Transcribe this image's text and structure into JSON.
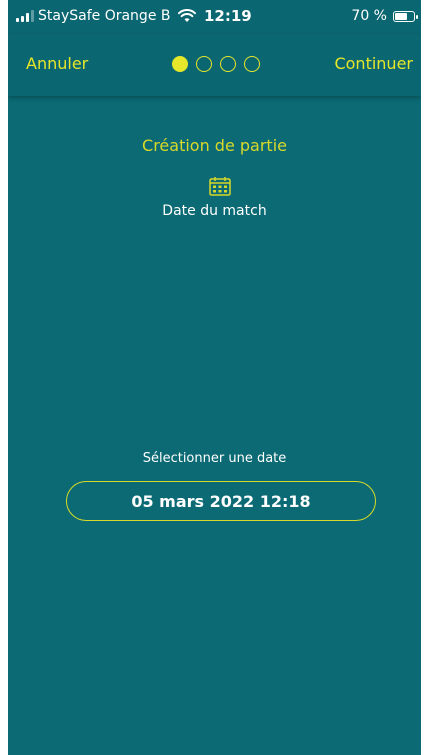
{
  "status_bar": {
    "carrier": "StaySafe Orange B",
    "time": "12:19",
    "battery_percent_label": "70 %",
    "battery_level": 0.7
  },
  "nav": {
    "cancel_label": "Annuler",
    "continue_label": "Continuer",
    "steps_total": 4,
    "current_step": 1
  },
  "content": {
    "title": "Création de partie",
    "icon": "calendar-icon",
    "subtitle": "Date du match",
    "select_label": "Sélectionner une date",
    "date_value": "05 mars 2022 12:18"
  },
  "colors": {
    "background": "#0b6a74",
    "accent": "#e6e72a",
    "text": "#ffffff"
  }
}
